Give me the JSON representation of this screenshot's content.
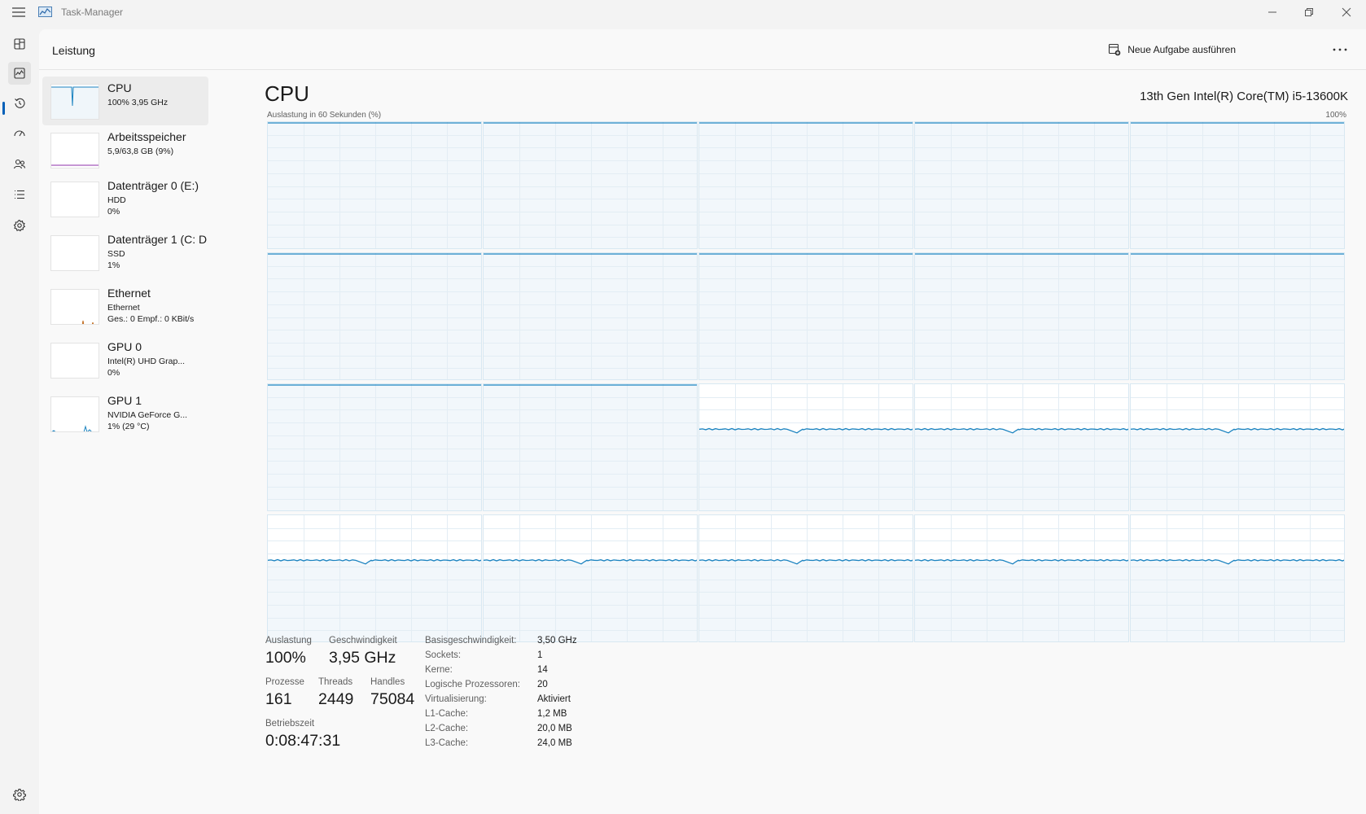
{
  "window": {
    "title": "Task-Manager"
  },
  "header": {
    "title": "Leistung",
    "run_task_label": "Neue Aufgabe ausführen"
  },
  "sidebar": {
    "items": [
      {
        "name": "CPU",
        "line1": "100%  3,95 GHz",
        "line2": "",
        "selected": true
      },
      {
        "name": "Arbeitsspeicher",
        "line1": "5,9/63,8 GB (9%)",
        "line2": ""
      },
      {
        "name": "Datenträger 0 (E:)",
        "line1": "HDD",
        "line2": "0%"
      },
      {
        "name": "Datenträger 1 (C: D",
        "line1": "SSD",
        "line2": "1%"
      },
      {
        "name": "Ethernet",
        "line1": "Ethernet",
        "line2": "Ges.: 0 Empf.: 0 KBit/s"
      },
      {
        "name": "GPU 0",
        "line1": "Intel(R) UHD Grap...",
        "line2": "0%"
      },
      {
        "name": "GPU 1",
        "line1": "NVIDIA GeForce G...",
        "line2": "1%  (29 °C)"
      }
    ]
  },
  "main": {
    "title": "CPU",
    "cpu_model": "13th Gen Intel(R) Core(TM) i5-13600K",
    "graph_caption": "Auslastung in 60 Sekunden (%)",
    "graph_max": "100%",
    "line_color": "#1b83c0",
    "fill_color": "#f0f6fa",
    "cores": [
      {
        "level": 1.0,
        "dip": 0.45
      },
      {
        "level": 1.0,
        "dip": 0.52
      },
      {
        "level": 1.0,
        "dip": 0.45
      },
      {
        "level": 1.0,
        "dip": 0.48
      },
      {
        "level": 1.0,
        "dip": 0.46
      },
      {
        "level": 1.0,
        "dip": 0.44
      },
      {
        "level": 1.0,
        "dip": 0.49
      },
      {
        "level": 1.0,
        "dip": 0.52
      },
      {
        "level": 1.0,
        "dip": 0.47
      },
      {
        "level": 1.0,
        "dip": 0.47
      },
      {
        "level": 1.0,
        "dip": 0.4
      },
      {
        "level": 1.0,
        "dip": 0.52
      },
      {
        "level": 0.65,
        "dip": 0.23
      },
      {
        "level": 0.65,
        "dip": 0.23
      },
      {
        "level": 0.65,
        "dip": 0.23
      },
      {
        "level": 0.65,
        "dip": 0.24
      },
      {
        "level": 0.65,
        "dip": 0.23
      },
      {
        "level": 0.65,
        "dip": 0.23
      },
      {
        "level": 0.65,
        "dip": 0.24
      },
      {
        "level": 0.65,
        "dip": 0.23
      }
    ]
  },
  "stats": {
    "util_label": "Auslastung",
    "util_value": "100%",
    "speed_label": "Geschwindigkeit",
    "speed_value": "3,95 GHz",
    "proc_label": "Prozesse",
    "proc_value": "161",
    "threads_label": "Threads",
    "threads_value": "2449",
    "handles_label": "Handles",
    "handles_value": "75084",
    "uptime_label": "Betriebszeit",
    "uptime_value": "0:08:47:31"
  },
  "specs": [
    {
      "label": "Basisgeschwindigkeit:",
      "value": "3,50 GHz"
    },
    {
      "label": "Sockets:",
      "value": "1"
    },
    {
      "label": "Kerne:",
      "value": "14"
    },
    {
      "label": "Logische Prozessoren:",
      "value": "20"
    },
    {
      "label": "Virtualisierung:",
      "value": "Aktiviert"
    },
    {
      "label": "L1-Cache:",
      "value": "1,2 MB"
    },
    {
      "label": "L2-Cache:",
      "value": "20,0 MB"
    },
    {
      "label": "L3-Cache:",
      "value": "24,0 MB"
    }
  ]
}
